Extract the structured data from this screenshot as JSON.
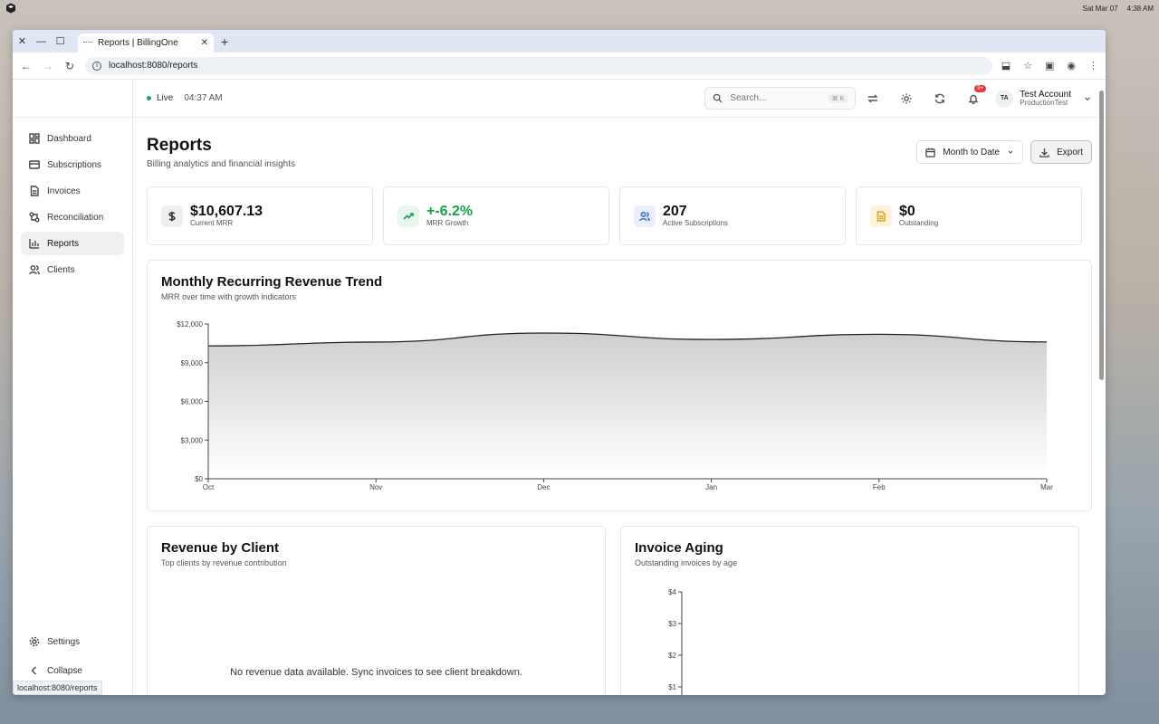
{
  "os": {
    "date": "Sat Mar 07",
    "time": "4:38 AM"
  },
  "browser": {
    "tab_title": "Reports | BillingOne",
    "url": "localhost:8080/reports",
    "status_url": "localhost:8080/reports"
  },
  "sidebar": {
    "items": [
      {
        "label": "Dashboard",
        "icon": "dashboard-icon"
      },
      {
        "label": "Subscriptions",
        "icon": "card-icon"
      },
      {
        "label": "Invoices",
        "icon": "file-icon"
      },
      {
        "label": "Reconciliation",
        "icon": "reconcile-icon"
      },
      {
        "label": "Reports",
        "icon": "bar-chart-icon",
        "active": true
      },
      {
        "label": "Clients",
        "icon": "users-icon"
      }
    ],
    "settings": "Settings",
    "collapse": "Collapse"
  },
  "header": {
    "live": "Live",
    "time": "04:37 AM",
    "search_placeholder": "Search...",
    "search_kbd": "⌘ K",
    "notif_badge": "9+",
    "avatar": "TA",
    "account_name": "Test Account",
    "account_sub": "ProductionTest"
  },
  "page": {
    "title": "Reports",
    "subtitle": "Billing analytics and financial insights",
    "range_label": "Month to Date",
    "export_label": "Export"
  },
  "kpis": [
    {
      "value": "$10,607.13",
      "label": "Current MRR",
      "color": "#111111",
      "icon": "dollar-icon",
      "bg": "#efefef",
      "stroke": "#333333"
    },
    {
      "value": "+-6.2%",
      "label": "MRR Growth",
      "color": "#16a34a",
      "icon": "trending-up-icon",
      "bg": "#e8f7ee",
      "stroke": "#16a34a"
    },
    {
      "value": "207",
      "label": "Active Subscriptions",
      "color": "#111111",
      "icon": "users-icon",
      "bg": "#e8eefb",
      "stroke": "#3b6fd8"
    },
    {
      "value": "$0",
      "label": "Outstanding",
      "color": "#111111",
      "icon": "document-icon",
      "bg": "#fdf3dc",
      "stroke": "#e0a020"
    }
  ],
  "mrr": {
    "title": "Monthly Recurring Revenue Trend",
    "subtitle": "MRR over time with growth indicators"
  },
  "revenue_by_client": {
    "title": "Revenue by Client",
    "subtitle": "Top clients by revenue contribution",
    "empty": "No revenue data available. Sync invoices to see client breakdown."
  },
  "invoice_aging": {
    "title": "Invoice Aging",
    "subtitle": "Outstanding invoices by age"
  },
  "chart_data": [
    {
      "type": "area",
      "x": [
        "Oct",
        "Nov",
        "Dec",
        "Jan",
        "Feb",
        "Mar"
      ],
      "values": [
        10300,
        10600,
        11300,
        10800,
        11200,
        10607.13
      ],
      "ylim": [
        0,
        12000
      ],
      "yticks": [
        "$0",
        "$3,000",
        "$6,000",
        "$9,000",
        "$12,000"
      ],
      "ytick_values": [
        0,
        3000,
        6000,
        9000,
        12000
      ],
      "line_color": "#222222",
      "grid": false
    },
    {
      "type": "bar",
      "values": [],
      "ylim": [
        0,
        4
      ],
      "yticks": [
        "$1",
        "$2",
        "$3",
        "$4"
      ],
      "ytick_values": [
        1,
        2,
        3,
        4
      ]
    }
  ]
}
